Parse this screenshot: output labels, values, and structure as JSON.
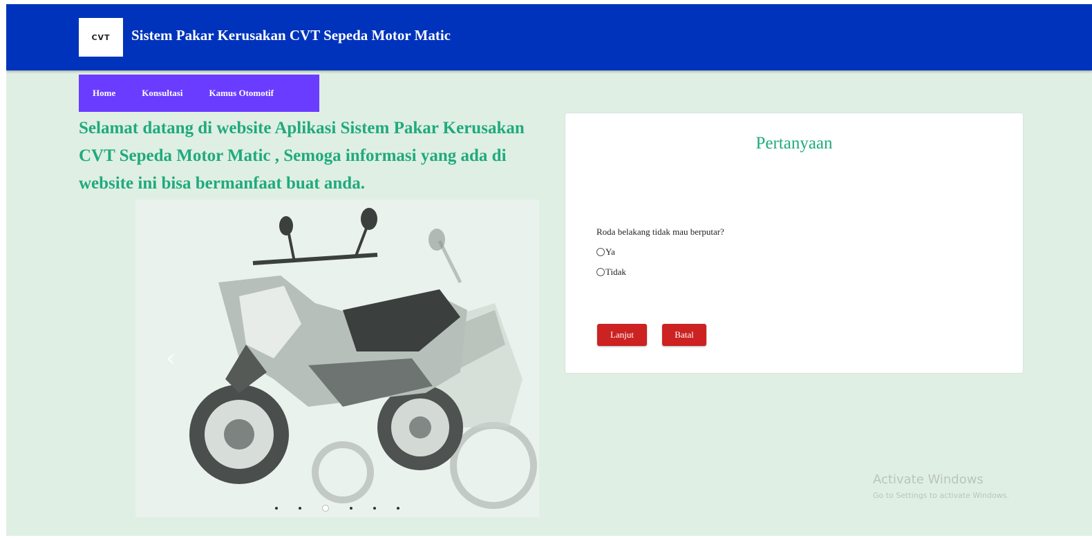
{
  "header": {
    "logo_text": "CVT",
    "title": "Sistem Pakar Kerusakan CVT Sepeda Motor Matic"
  },
  "nav": {
    "items": [
      {
        "label": "Home"
      },
      {
        "label": "Konsultasi"
      },
      {
        "label": "Kamus Otomotif"
      }
    ]
  },
  "welcome": {
    "text": "Selamat datang di website Aplikasi Sistem Pakar Kerusakan CVT Sepeda Motor Matic , Semoga informasi yang ada di website ini bisa bermanfaat buat anda."
  },
  "carousel": {
    "image_icon": "scooter-image",
    "prev_icon": "chevron-left-icon",
    "indicator_count": 6,
    "active_indicator": 3
  },
  "question_card": {
    "title": "Pertanyaan",
    "question": "Roda belakang tidak mau berputar?",
    "options": [
      "Ya",
      "Tidak"
    ],
    "selected_option": null,
    "buttons": {
      "next_label": "Lanjut",
      "cancel_label": "Batal"
    }
  },
  "watermark": {
    "title": "Activate Windows",
    "subtitle": "Go to Settings to activate Windows."
  },
  "colors": {
    "header_bg": "#0033bb",
    "nav_bg": "#6a3cff",
    "page_bg": "#e0efe3",
    "accent_green": "#1faa7f",
    "button_red": "#cc2222"
  }
}
